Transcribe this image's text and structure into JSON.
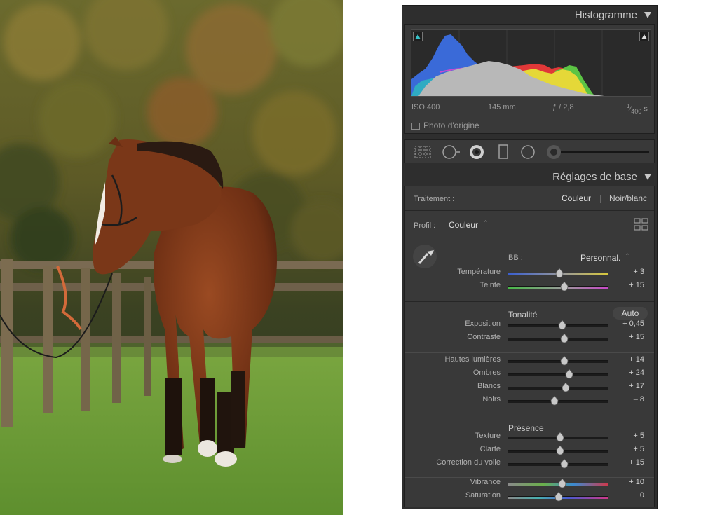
{
  "photo": {
    "alt": "horse-photo"
  },
  "histogram": {
    "title": "Histogramme",
    "iso": "ISO 400",
    "focal": "145 mm",
    "aperture": "ƒ / 2,8",
    "shutter_num": "1",
    "shutter_den": "400",
    "shutter_unit": "s",
    "original_label": "Photo d'origine"
  },
  "basic": {
    "title": "Réglages de base",
    "treatment_label": "Traitement :",
    "treatment_color": "Couleur",
    "treatment_bw": "Noir/blanc",
    "profile_label": "Profil :",
    "profile_value": "Couleur",
    "wb_label": "BB :",
    "wb_value": "Personnal.",
    "tone_title": "Tonalité",
    "auto_label": "Auto",
    "presence_title": "Présence",
    "sliders": [
      {
        "label": "Température",
        "value": "+ 3",
        "pos": 0.51,
        "track": "temp"
      },
      {
        "label": "Teinte",
        "value": "+ 15",
        "pos": 0.56,
        "track": "tint"
      },
      {
        "label": "Exposition",
        "value": "+ 0,45",
        "pos": 0.54,
        "track": "gray"
      },
      {
        "label": "Contraste",
        "value": "+ 15",
        "pos": 0.56,
        "track": "gray"
      },
      {
        "label": "Hautes lumières",
        "value": "+ 14",
        "pos": 0.56,
        "track": "gray"
      },
      {
        "label": "Ombres",
        "value": "+ 24",
        "pos": 0.61,
        "track": "gray"
      },
      {
        "label": "Blancs",
        "value": "+ 17",
        "pos": 0.57,
        "track": "gray"
      },
      {
        "label": "Noirs",
        "value": "– 8",
        "pos": 0.46,
        "track": "gray"
      },
      {
        "label": "Texture",
        "value": "+ 5",
        "pos": 0.52,
        "track": "gray"
      },
      {
        "label": "Clarté",
        "value": "+ 5",
        "pos": 0.52,
        "track": "gray"
      },
      {
        "label": "Correction du voile",
        "value": "+ 15",
        "pos": 0.56,
        "track": "gray"
      },
      {
        "label": "Vibrance",
        "value": "+ 10",
        "pos": 0.54,
        "track": "vib"
      },
      {
        "label": "Saturation",
        "value": "0",
        "pos": 0.5,
        "track": "sat"
      }
    ]
  }
}
